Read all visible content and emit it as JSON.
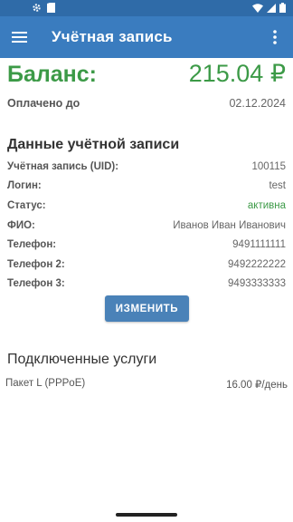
{
  "app": {
    "title": "Учётная запись"
  },
  "balance": {
    "label": "Баланс:",
    "value": "215.04 ₽"
  },
  "paid_until": {
    "label": "Оплачено до",
    "value": "02.12.2024"
  },
  "account_section": {
    "title": "Данные учётной записи",
    "rows": [
      {
        "label": "Учётная запись (UID):",
        "value": "100115"
      },
      {
        "label": "Логин:",
        "value": "test"
      },
      {
        "label": "Статус:",
        "value": "активна"
      },
      {
        "label": "ФИО:",
        "value": "Иванов Иван Иванович"
      },
      {
        "label": "Телефон:",
        "value": "9491111111"
      },
      {
        "label": "Телефон 2:",
        "value": "9492222222"
      },
      {
        "label": "Телефон 3:",
        "value": "9493333333"
      }
    ],
    "edit_button": "ИЗМЕНИТЬ"
  },
  "services_section": {
    "title": "Подключенные услуги",
    "items": [
      {
        "name": "Пакет L (PPPoE)",
        "price": "16.00 ₽/день"
      }
    ]
  },
  "colors": {
    "appbar": "#3a7cbf",
    "statusbar": "#2f6ba8",
    "accent_green": "#3c9a47",
    "button": "#4a82b8"
  },
  "icons": [
    "gear-icon",
    "sim-icon",
    "wifi-icon",
    "signal-icon",
    "battery-icon",
    "menu-icon",
    "more-vert-icon"
  ]
}
